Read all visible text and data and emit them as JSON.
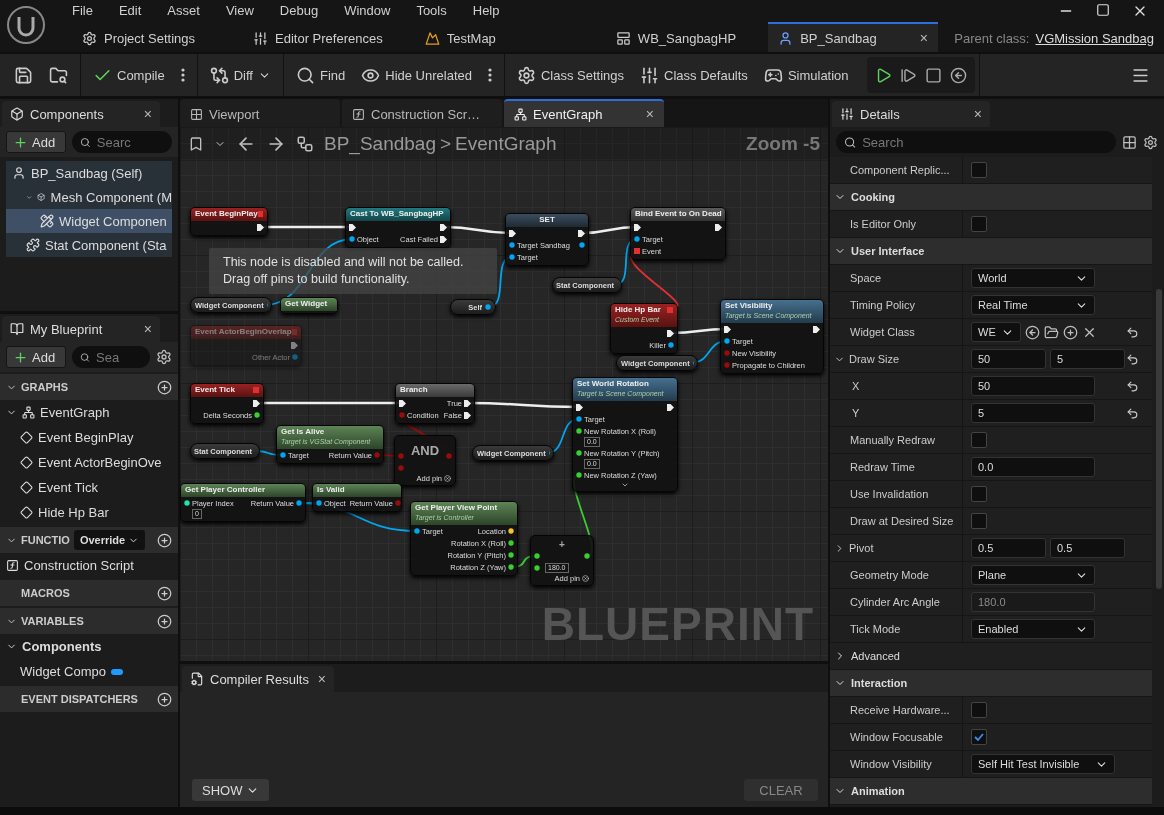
{
  "menu": [
    "File",
    "Edit",
    "Asset",
    "View",
    "Debug",
    "Window",
    "Tools",
    "Help"
  ],
  "asset_tabs": [
    {
      "label": "Project Settings",
      "kind": "settings",
      "selected": false
    },
    {
      "label": "Editor Preferences",
      "kind": "prefs",
      "selected": false
    },
    {
      "label": "TestMap",
      "kind": "map",
      "selected": false
    },
    {
      "label": "WB_SangbagHP",
      "kind": "widget",
      "selected": false
    },
    {
      "label": "BP_Sandbag",
      "kind": "blueprint",
      "selected": true,
      "close": "×"
    }
  ],
  "parent_class": {
    "label": "Parent class:",
    "value": "VGMission Sandbag"
  },
  "toolbar": [
    {
      "kind": "save"
    },
    {
      "kind": "browse"
    },
    {
      "kind": "compile",
      "label": "Compile"
    },
    {
      "kind": "more"
    },
    {
      "kind": "diff",
      "label": "Diff"
    },
    {
      "kind": "find",
      "label": "Find"
    },
    {
      "kind": "hide",
      "label": "Hide Unrelated"
    },
    {
      "kind": "more"
    },
    {
      "kind": "class_settings",
      "label": "Class Settings"
    },
    {
      "kind": "class_defaults",
      "label": "Class Defaults"
    },
    {
      "kind": "simulation",
      "label": "Simulation"
    },
    {
      "kind": "play"
    },
    {
      "kind": "step"
    },
    {
      "kind": "stop"
    },
    {
      "kind": "eject"
    },
    {
      "kind": "menu"
    }
  ],
  "components_panel": {
    "title": "Components",
    "close": "×",
    "add": "Add",
    "search_placeholder": "Searc",
    "tree": [
      {
        "label": "BP_Sandbag (Self)",
        "kind": "actor",
        "selected": false,
        "children": [
          {
            "label": "Mesh Component (M",
            "kind": "mesh",
            "selected": false,
            "expanded": true,
            "children": [
              {
                "label": "Widget Componen",
                "kind": "widget",
                "selected": true
              }
            ]
          },
          {
            "label": "Stat Component (Sta",
            "kind": "component",
            "selected": false
          }
        ]
      }
    ]
  },
  "my_blueprint": {
    "title": "My Blueprint",
    "close": "×",
    "add": "Add",
    "search_placeholder": "Sea",
    "sections": [
      {
        "title": "GRAPHS",
        "expanded": true,
        "items": [
          {
            "label": "EventGraph",
            "kind": "graph",
            "expanded": true,
            "children": [
              {
                "label": "Event BeginPlay",
                "kind": "event"
              },
              {
                "label": "Event ActorBeginOve",
                "kind": "event"
              },
              {
                "label": "Event Tick",
                "kind": "event"
              },
              {
                "label": "Hide Hp Bar",
                "kind": "event"
              }
            ]
          }
        ]
      },
      {
        "title": "FUNCTIO",
        "expanded": true,
        "dropdown": "Override",
        "items": [
          {
            "label": "Construction Script",
            "kind": "function"
          }
        ]
      },
      {
        "title": "MACROS"
      },
      {
        "title": "VARIABLES",
        "expanded": true,
        "items": [
          {
            "label": "Components",
            "kind": "category",
            "expanded": true,
            "children": [
              {
                "label": "Widget Compo",
                "kind": "variable"
              }
            ]
          }
        ]
      },
      {
        "title": "EVENT DISPATCHERS"
      }
    ]
  },
  "graph_tabs": [
    {
      "label": "Viewport",
      "kind": "viewport",
      "selected": false
    },
    {
      "label": "Construction Scr…",
      "kind": "function",
      "selected": false
    },
    {
      "label": "EventGraph",
      "kind": "graph",
      "selected": true,
      "close": "×"
    }
  ],
  "breadcrumb": {
    "blueprint": "BP_Sandbag",
    "separator": ">",
    "graph": "EventGraph",
    "zoom": "Zoom -5"
  },
  "nodes": [
    {
      "kind": "event",
      "title": "Event BeginPlay",
      "outputs": [
        {
          "kind": "exec"
        }
      ]
    },
    {
      "kind": "cast",
      "title": "Cast To WB_SangbagHP",
      "inputs": [
        {
          "kind": "exec"
        },
        {
          "label": "Object",
          "kind": "object"
        }
      ],
      "outputs": [
        {
          "kind": "exec"
        },
        {
          "label": "Cast Failed",
          "kind": "exec"
        }
      ]
    },
    {
      "kind": "variable",
      "title": "Widget Component",
      "outputs": [
        {
          "kind": "object"
        }
      ]
    },
    {
      "kind": "pure",
      "title": "Get Widget"
    },
    {
      "kind": "event",
      "title": "Event ActorBeginOverlap",
      "disabled": true,
      "outputs": [
        {
          "kind": "exec"
        },
        {
          "label": "Other Actor",
          "kind": "object"
        }
      ]
    },
    {
      "kind": "set",
      "title": "SET",
      "inputs": [
        {
          "kind": "exec"
        },
        {
          "label": "Target Sandbag",
          "kind": "object"
        },
        {
          "label": "Target",
          "kind": "object"
        }
      ],
      "outputs": [
        {
          "kind": "exec"
        },
        {
          "kind": "object"
        }
      ]
    },
    {
      "kind": "variable",
      "title": "Self",
      "outputs": [
        {
          "kind": "object"
        }
      ]
    },
    {
      "kind": "bind",
      "title": "Bind Event to On Dead",
      "inputs": [
        {
          "kind": "exec"
        },
        {
          "label": "Target",
          "kind": "object"
        },
        {
          "label": "Event",
          "kind": "delegate"
        }
      ],
      "outputs": [
        {
          "kind": "exec"
        }
      ]
    },
    {
      "kind": "variable",
      "title": "Stat Component",
      "outputs": [
        {
          "kind": "object"
        }
      ]
    },
    {
      "kind": "event",
      "title": "Hide Hp Bar",
      "subtitle": "Custom Event",
      "outputs": [
        {
          "kind": "exec"
        },
        {
          "label": "Killer",
          "kind": "object"
        }
      ]
    },
    {
      "kind": "variable",
      "title": "Widget Component",
      "outputs": [
        {
          "kind": "object"
        }
      ]
    },
    {
      "kind": "function",
      "title": "Set Visibility",
      "subtitle": "Target is Scene Component",
      "inputs": [
        {
          "kind": "exec"
        },
        {
          "label": "Target",
          "kind": "object"
        },
        {
          "label": "New Visibility",
          "kind": "bool"
        },
        {
          "label": "Propagate to Children",
          "kind": "bool"
        }
      ],
      "outputs": [
        {
          "kind": "exec"
        }
      ]
    },
    {
      "kind": "event",
      "title": "Event Tick",
      "outputs": [
        {
          "kind": "exec"
        },
        {
          "label": "Delta Seconds",
          "kind": "float"
        }
      ]
    },
    {
      "kind": "macro",
      "title": "Branch",
      "inputs": [
        {
          "kind": "exec"
        },
        {
          "label": "Condition",
          "kind": "bool"
        }
      ],
      "outputs": [
        {
          "label": "True",
          "kind": "exec"
        },
        {
          "label": "False",
          "kind": "exec"
        }
      ]
    },
    {
      "kind": "function",
      "title": "Set World Rotation",
      "subtitle": "Target is Scene Component",
      "advanced": true,
      "inputs": [
        {
          "kind": "exec"
        },
        {
          "label": "Target",
          "kind": "object"
        },
        {
          "label": "New Rotation X (Roll)",
          "kind": "float",
          "value": "0.0"
        },
        {
          "label": "New Rotation Y (Pitch)",
          "kind": "float",
          "value": "0.0"
        },
        {
          "label": "New Rotation Z (Yaw)",
          "kind": "float"
        }
      ],
      "outputs": [
        {
          "kind": "exec"
        }
      ]
    },
    {
      "kind": "variable",
      "title": "Stat Component",
      "outputs": [
        {
          "kind": "object"
        }
      ]
    },
    {
      "kind": "pure",
      "title": "Get Is Alive",
      "subtitle": "Target is VGStat Component",
      "inputs": [
        {
          "label": "Target",
          "kind": "object"
        }
      ],
      "outputs": [
        {
          "label": "Return Value",
          "kind": "bool"
        }
      ]
    },
    {
      "kind": "operator",
      "title": "AND",
      "footer": "Add pin",
      "inputs": [
        {
          "kind": "bool"
        },
        {
          "kind": "bool"
        }
      ],
      "outputs": [
        {
          "kind": "bool"
        }
      ]
    },
    {
      "kind": "variable",
      "title": "Widget Component",
      "outputs": [
        {
          "kind": "object"
        }
      ]
    },
    {
      "kind": "pure",
      "title": "Get Player Controller",
      "inputs": [
        {
          "label": "Player Index",
          "kind": "int",
          "value": "0"
        }
      ],
      "outputs": [
        {
          "label": "Return Value",
          "kind": "object"
        }
      ]
    },
    {
      "kind": "pure",
      "title": "Is Valid",
      "inputs": [
        {
          "label": "Object",
          "kind": "object"
        }
      ],
      "outputs": [
        {
          "label": "Return Value",
          "kind": "bool"
        }
      ]
    },
    {
      "kind": "pure",
      "title": "Get Player View Point",
      "subtitle": "Target is Controller",
      "inputs": [
        {
          "label": "Target",
          "kind": "object"
        }
      ],
      "outputs": [
        {
          "label": "Location",
          "kind": "vector"
        },
        {
          "label": "Rotation X (Roll)",
          "kind": "float"
        },
        {
          "label": "Rotation Y (Pitch)",
          "kind": "float"
        },
        {
          "label": "Rotation Z (Yaw)",
          "kind": "float"
        }
      ]
    },
    {
      "kind": "operator",
      "title": "+",
      "footer": "Add pin",
      "inputs": [
        {
          "kind": "float"
        },
        {
          "kind": "float",
          "value": "180.0"
        }
      ],
      "outputs": [
        {
          "kind": "float"
        }
      ]
    }
  ],
  "tooltip": "This node is disabled and will not be called.\nDrag off pins to build functionality.",
  "watermark": "BLUEPRINT",
  "compiler": {
    "tab": "Compiler Results",
    "close": "×",
    "show": "SHOW",
    "clear": "CLEAR"
  },
  "details": {
    "title": "Details",
    "close": "×",
    "search_placeholder": "Search",
    "rows": [
      {
        "kind": "checkbox",
        "label": "Component Replic...",
        "checked": false,
        "reset": false
      },
      {
        "kind": "section",
        "label": "Cooking",
        "expanded": true
      },
      {
        "kind": "checkbox",
        "label": "Is Editor Only",
        "checked": false,
        "reset": false
      },
      {
        "kind": "section",
        "label": "User Interface",
        "expanded": true
      },
      {
        "kind": "dropdown",
        "label": "Space",
        "value": "World",
        "reset": false
      },
      {
        "kind": "dropdown",
        "label": "Timing Policy",
        "value": "Real Time",
        "reset": false
      },
      {
        "kind": "class",
        "label": "Widget Class",
        "value": "WE",
        "reset": true
      },
      {
        "kind": "vector",
        "label": "Draw Size",
        "values": [
          "50",
          "5"
        ],
        "expanded": true,
        "reset": true
      },
      {
        "kind": "number",
        "label": "X",
        "value": "50",
        "sub": true,
        "reset": true
      },
      {
        "kind": "number",
        "label": "Y",
        "value": "5",
        "sub": true,
        "reset": true
      },
      {
        "kind": "checkbox",
        "label": "Manually Redraw",
        "checked": false,
        "reset": false
      },
      {
        "kind": "number",
        "label": "Redraw Time",
        "value": "0.0",
        "reset": false
      },
      {
        "kind": "checkbox",
        "label": "Use Invalidation",
        "checked": false,
        "reset": false
      },
      {
        "kind": "checkbox",
        "label": "Draw at Desired Size",
        "checked": false,
        "reset": false
      },
      {
        "kind": "vector",
        "label": "Pivot",
        "values": [
          "0.5",
          "0.5"
        ],
        "expanded": false,
        "reset": false
      },
      {
        "kind": "dropdown",
        "label": "Geometry Mode",
        "value": "Plane",
        "reset": false
      },
      {
        "kind": "number",
        "label": "Cylinder Arc Angle",
        "value": "180.0",
        "disabled": true,
        "reset": false
      },
      {
        "kind": "dropdown",
        "label": "Tick Mode",
        "value": "Enabled",
        "reset": false
      },
      {
        "kind": "expander",
        "label": "Advanced",
        "expanded": false
      },
      {
        "kind": "section",
        "label": "Interaction",
        "expanded": true
      },
      {
        "kind": "checkbox",
        "label": "Receive Hardware...",
        "checked": false,
        "reset": false
      },
      {
        "kind": "checkbox",
        "label": "Window Focusable",
        "checked": true,
        "reset": false
      },
      {
        "kind": "dropdown",
        "label": "Window Visibility",
        "value": "Self Hit Test Invisible",
        "reset": false
      },
      {
        "kind": "section",
        "label": "Animation",
        "expanded": true
      }
    ]
  }
}
